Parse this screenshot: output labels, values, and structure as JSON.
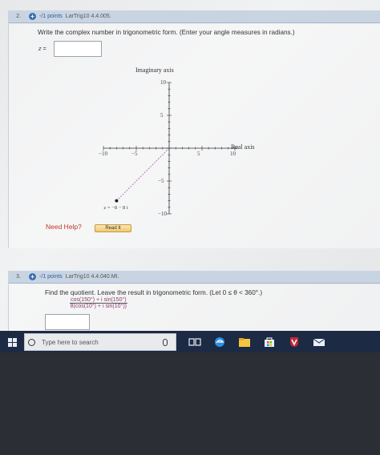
{
  "q2": {
    "number": "2.",
    "points": "-/1 points",
    "source": "LarTrig10 4.4.005.",
    "prompt": "Write the complex number in trigonometric form. (Enter your angle measures in radians.)",
    "answer_label": "z =",
    "answer_value": "",
    "help_label": "Need Help?",
    "read_button": "Read It"
  },
  "chart_data": {
    "type": "scatter",
    "xlabel": "Real axis",
    "ylabel": "Imaginary axis",
    "xlim": [
      -10,
      10
    ],
    "ylim": [
      -10,
      10
    ],
    "x_ticks": [
      -10,
      -5,
      5,
      10
    ],
    "y_ticks": [
      10,
      5,
      -5,
      -10
    ],
    "x_tick_labels": [
      "−10",
      "−5",
      "5",
      "10"
    ],
    "y_tick_labels": [
      "10",
      "5",
      "−5",
      "−10"
    ],
    "points": [
      {
        "x": -8,
        "y": -8,
        "label": "z = −8 − 8 i"
      }
    ],
    "line_from_origin": true,
    "grid": false,
    "colors": {
      "axes": "#333333",
      "point": "#222222",
      "line": "#c065c0"
    }
  },
  "q3": {
    "number": "3.",
    "points": "-/1 points",
    "source": "LarTrig10 4.4.040.MI.",
    "prompt": "Find the quotient. Leave the result in trigonometric form. (Let 0 ≤ θ < 360°.)",
    "numerator": "cos(150°) + i sin(150°)",
    "denominator": "8(cos(10°) + i sin(10°))",
    "answer_value": ""
  },
  "taskbar": {
    "search_placeholder": "Type here to search",
    "icons": [
      "windows-icon",
      "search-circle-icon",
      "microphone-icon",
      "task-view-icon",
      "edge-icon",
      "file-explorer-icon",
      "store-icon",
      "antivirus-icon",
      "mail-icon"
    ]
  }
}
